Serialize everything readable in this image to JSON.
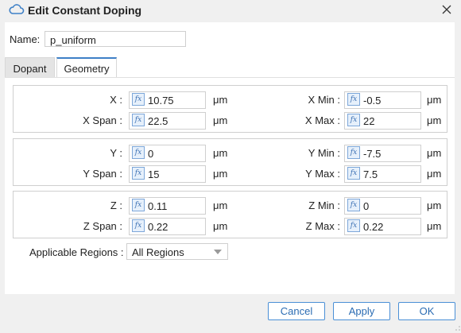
{
  "window": {
    "title": "Edit Constant Doping"
  },
  "name_field": {
    "label": "Name:",
    "value": "p_uniform"
  },
  "tabs": [
    {
      "label": "Dopant",
      "active": false
    },
    {
      "label": "Geometry",
      "active": true
    }
  ],
  "groups": [
    {
      "rows": [
        {
          "left_label": "X :",
          "left_value": "10.75",
          "left_unit": "μm",
          "right_label": "X Min :",
          "right_value": "-0.5",
          "right_unit": "μm"
        },
        {
          "left_label": "X Span :",
          "left_value": "22.5",
          "left_unit": "μm",
          "right_label": "X Max :",
          "right_value": "22",
          "right_unit": "μm"
        }
      ]
    },
    {
      "rows": [
        {
          "left_label": "Y :",
          "left_value": "0",
          "left_unit": "μm",
          "right_label": "Y Min :",
          "right_value": "-7.5",
          "right_unit": "μm"
        },
        {
          "left_label": "Y Span :",
          "left_value": "15",
          "left_unit": "μm",
          "right_label": "Y Max :",
          "right_value": "7.5",
          "right_unit": "μm"
        }
      ]
    },
    {
      "rows": [
        {
          "left_label": "Z :",
          "left_value": "0.11",
          "left_unit": "μm",
          "right_label": "Z Min :",
          "right_value": "0",
          "right_unit": "μm"
        },
        {
          "left_label": "Z Span :",
          "left_value": "0.22",
          "left_unit": "μm",
          "right_label": "Z Max :",
          "right_value": "0.22",
          "right_unit": "μm"
        }
      ]
    }
  ],
  "regions": {
    "label": "Applicable Regions :",
    "selected": "All Regions"
  },
  "buttons": {
    "cancel": "Cancel",
    "apply": "Apply",
    "ok": "OK"
  },
  "icons": {
    "title": "cloud-icon",
    "close": "close-icon",
    "formula": "fx-icon"
  },
  "colors": {
    "accent": "#3e80c7",
    "button_text": "#2b6cb3"
  }
}
